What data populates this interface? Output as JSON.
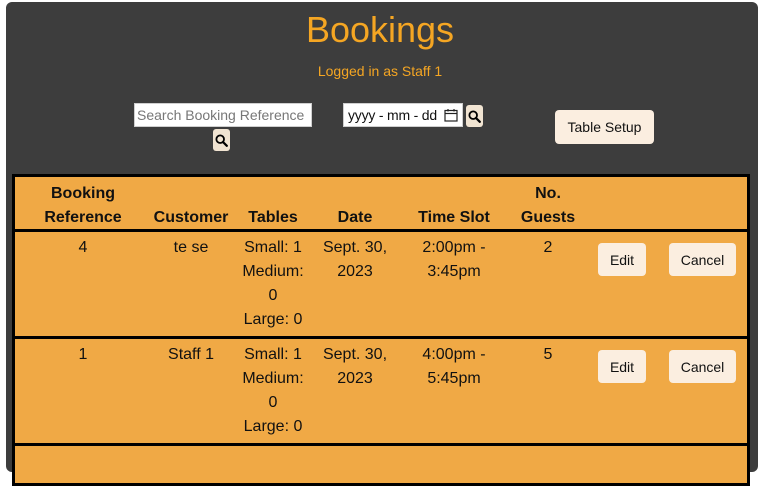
{
  "header": {
    "title": "Bookings",
    "subtitle": "Logged in as Staff 1"
  },
  "toolbar": {
    "search_placeholder": "Search Booking Reference",
    "date_placeholder": "yyyy - mm - dd",
    "table_setup_label": "Table Setup"
  },
  "table": {
    "columns": {
      "booking_reference_1": "Booking",
      "booking_reference_2": "Reference",
      "customer": "Customer",
      "tables": "Tables",
      "date": "Date",
      "time_slot": "Time Slot",
      "guests_1": "No.",
      "guests_2": "Guests"
    },
    "rows": [
      {
        "reference": "4",
        "customer": "te se",
        "tables": [
          "Small: 1",
          "Medium:",
          "0",
          "Large: 0"
        ],
        "date": [
          "Sept. 30,",
          "2023"
        ],
        "time_slot": [
          "2:00pm -",
          "3:45pm"
        ],
        "guests": "2",
        "edit_label": "Edit",
        "cancel_label": "Cancel"
      },
      {
        "reference": "1",
        "customer": "Staff 1",
        "tables": [
          "Small: 1",
          "Medium:",
          "0",
          "Large: 0"
        ],
        "date": [
          "Sept. 30,",
          "2023"
        ],
        "time_slot": [
          "4:00pm -",
          "5:45pm"
        ],
        "guests": "5",
        "edit_label": "Edit",
        "cancel_label": "Cancel"
      }
    ]
  },
  "colors": {
    "panel_bg": "#3d3d3d",
    "accent": "#f5a623",
    "table_bg": "#f0a945",
    "button_bg": "#fbeee0"
  }
}
